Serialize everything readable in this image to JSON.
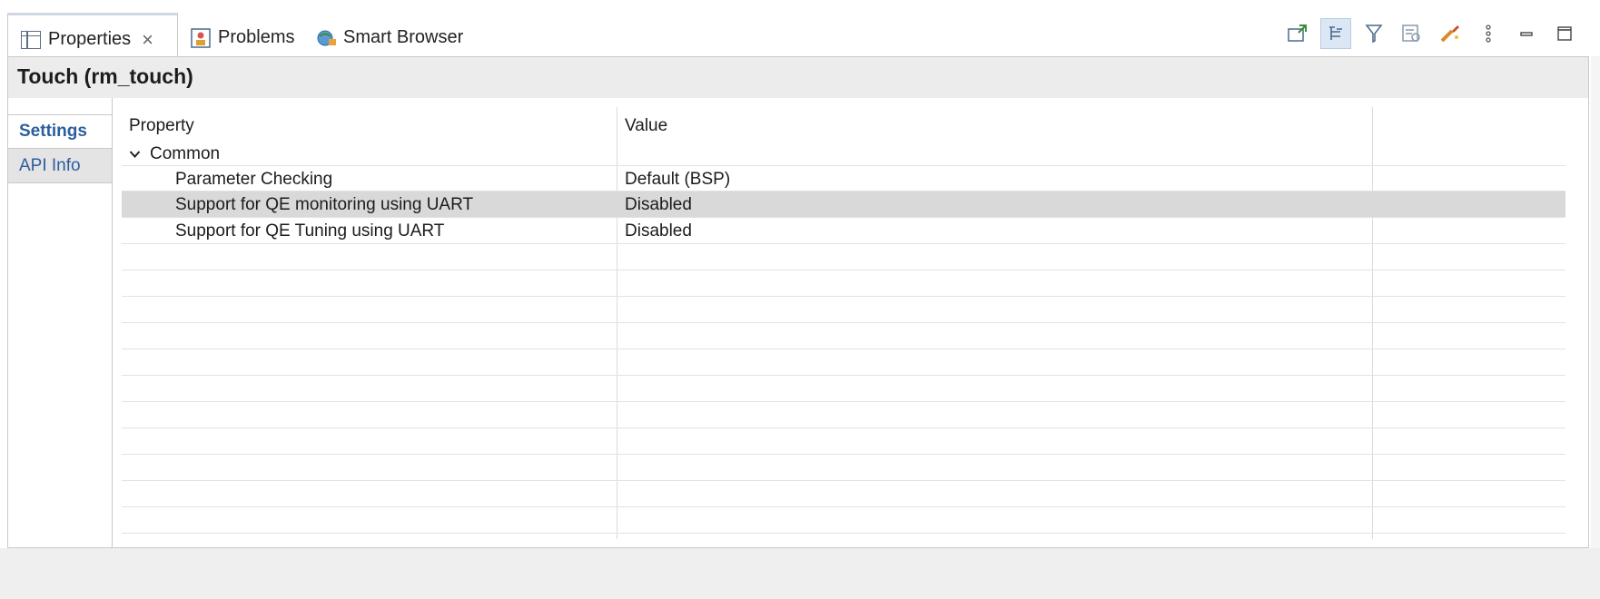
{
  "tabs": [
    {
      "label": "Properties",
      "icon": "properties-icon",
      "active": true
    },
    {
      "label": "Problems",
      "icon": "problems-icon",
      "active": false
    },
    {
      "label": "Smart Browser",
      "icon": "smart-browser-icon",
      "active": false
    }
  ],
  "toolbar_icons": [
    "pin-icon",
    "show-categories-icon",
    "filter-icon",
    "advanced-icon",
    "restore-default-icon",
    "view-menu-icon",
    "minimize-icon",
    "maximize-icon"
  ],
  "header": {
    "title": "Touch (rm_touch)"
  },
  "side_tabs": [
    {
      "label": "Settings",
      "active": true
    },
    {
      "label": "API Info",
      "active": false
    }
  ],
  "table": {
    "columns": [
      "Property",
      "Value"
    ],
    "group": {
      "label": "Common",
      "expanded": true
    },
    "rows": [
      {
        "property": "Parameter Checking",
        "value": "Default (BSP)",
        "selected": false
      },
      {
        "property": "Support for QE monitoring using UART",
        "value": "Disabled",
        "selected": true
      },
      {
        "property": "Support for QE Tuning using UART",
        "value": "Disabled",
        "selected": false
      }
    ]
  },
  "colors": {
    "accent_text": "#2c5e9e",
    "selected_row": "#d9d9d9",
    "header_bg": "#ececec"
  }
}
